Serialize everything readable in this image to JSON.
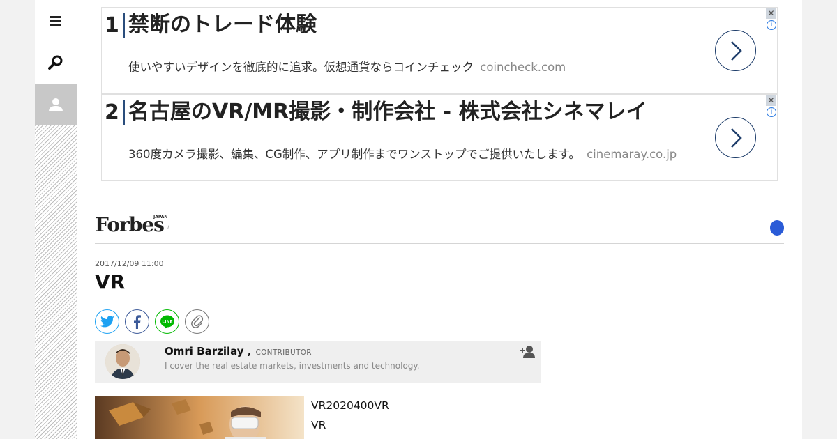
{
  "sidebar": {
    "menu_icon": "hamburger-icon",
    "search_icon": "search-icon",
    "user_icon": "user-icon"
  },
  "ads": [
    {
      "num": "1",
      "title": "禁断のトレード体験",
      "desc": "使いやすいデザインを徹底的に追求。仮想通貨ならコインチェック",
      "domain": "coincheck.com"
    },
    {
      "num": "2",
      "title": "名古屋のVR/MR撮影・制作会社 - 株式会社シネマレイ",
      "desc": "360度カメラ撮影、編集、CG制作、アプリ制作までワンストップでご提供いたします。",
      "domain": "cinemaray.co.jp"
    }
  ],
  "header": {
    "logo": "Forbes",
    "logo_sub": "JAPAN",
    "separator": "/"
  },
  "article": {
    "date": "2017/12/09 11:00",
    "title": "VR",
    "author_name": "Omri Barzilay ,",
    "author_role": "CONTRIBUTOR",
    "author_bio": "I cover the real estate markets, investments and technology.",
    "lead_line1": "VR2020400VR",
    "lead_line2": "VR"
  },
  "colors": {
    "twitter": "#1da1f2",
    "facebook": "#3b5998",
    "line": "#00b900",
    "accent_dot": "#2a5bd7",
    "ad_border_accent": "#1f3e6b"
  }
}
